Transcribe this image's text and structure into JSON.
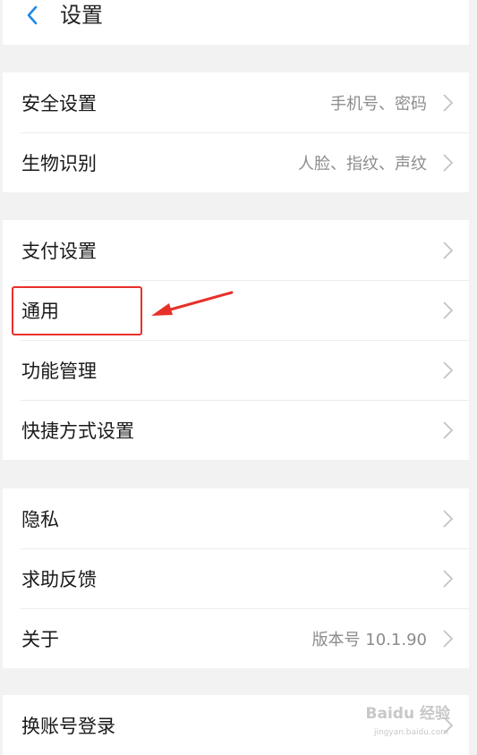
{
  "header": {
    "title": "设置",
    "back_icon": "chevron-left-icon"
  },
  "groups": [
    {
      "items": [
        {
          "label": "安全设置",
          "value": "手机号、密码"
        },
        {
          "label": "生物识别",
          "value": "人脸、指纹、声纹"
        }
      ]
    },
    {
      "items": [
        {
          "label": "支付设置",
          "value": ""
        },
        {
          "label": "通用",
          "value": ""
        },
        {
          "label": "功能管理",
          "value": ""
        },
        {
          "label": "快捷方式设置",
          "value": ""
        }
      ]
    },
    {
      "items": [
        {
          "label": "隐私",
          "value": ""
        },
        {
          "label": "求助反馈",
          "value": ""
        },
        {
          "label": "关于",
          "value": "版本号 10.1.90"
        }
      ]
    },
    {
      "items": [
        {
          "label": "换账号登录",
          "value": ""
        }
      ]
    }
  ],
  "annotation": {
    "highlight_color": "#e8302a"
  },
  "watermark": {
    "brand": "Baidu 经验",
    "url": "jingyan.baidu.com"
  },
  "colors": {
    "accent": "#1e88e5",
    "background": "#f2f2f2"
  }
}
